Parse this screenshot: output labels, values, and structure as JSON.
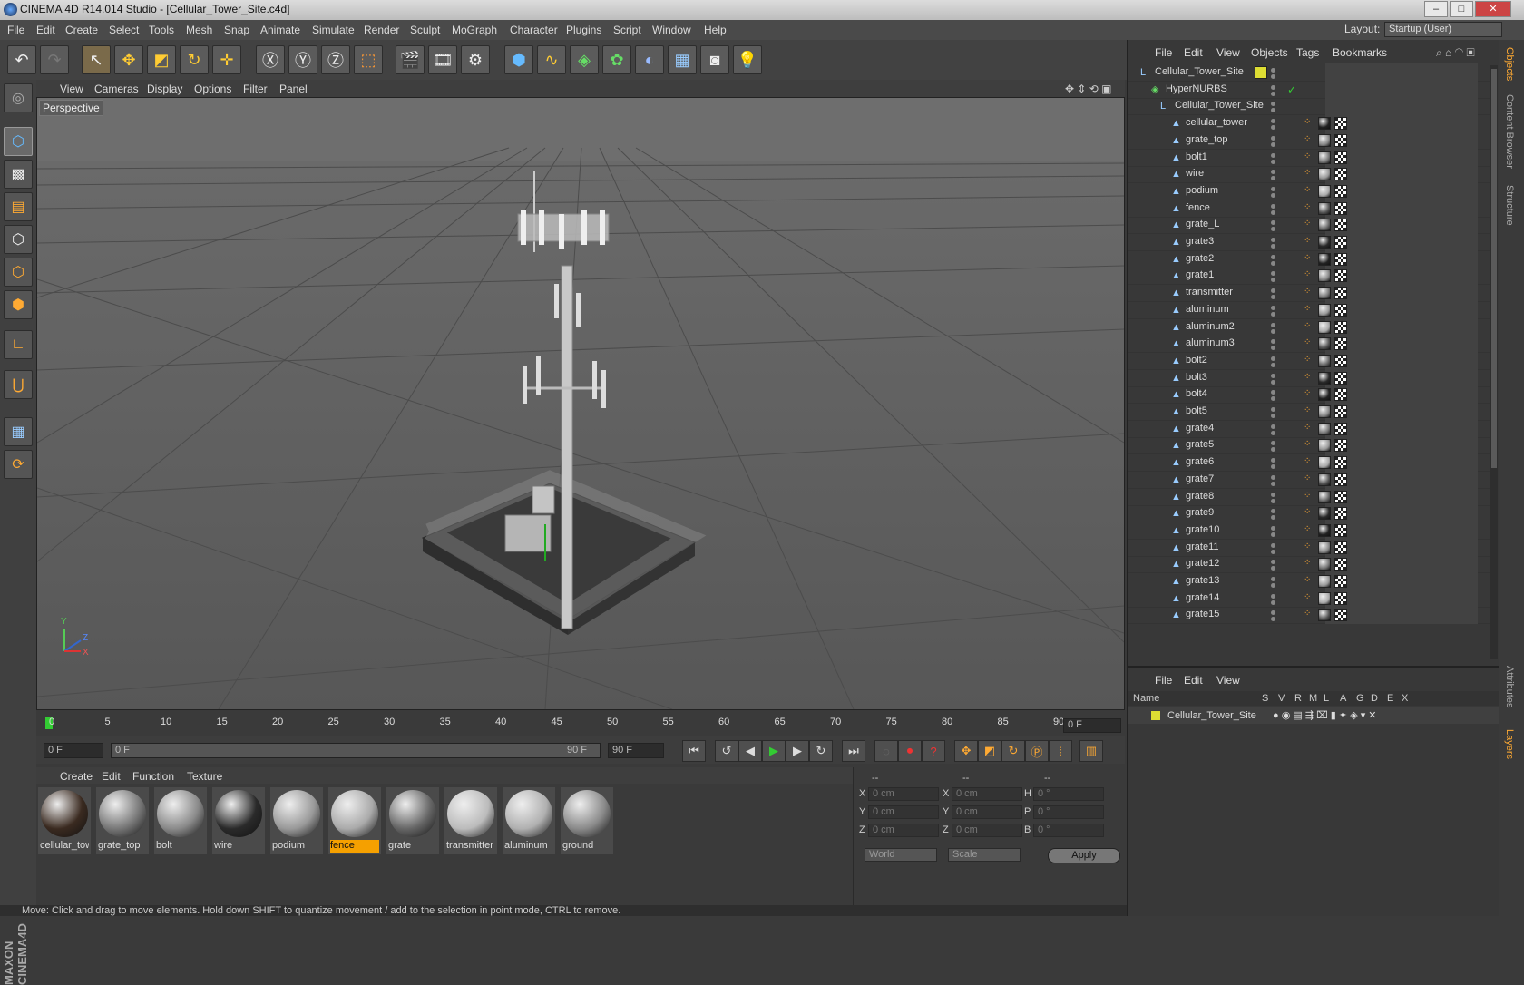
{
  "window": {
    "title": "CINEMA 4D R14.014 Studio - [Cellular_Tower_Site.c4d]"
  },
  "menubar": {
    "items": [
      "File",
      "Edit",
      "Create",
      "Select",
      "Tools",
      "Mesh",
      "Snap",
      "Animate",
      "Simulate",
      "Render",
      "Sculpt",
      "MoGraph",
      "Character",
      "Plugins",
      "Script",
      "Window",
      "Help"
    ],
    "layout_label": "Layout:",
    "layout_value": "Startup (User)"
  },
  "viewport": {
    "menu": [
      "View",
      "Cameras",
      "Display",
      "Options",
      "Filter",
      "Panel"
    ],
    "label": "Perspective",
    "axis_y": "Y",
    "axis_z": "Z",
    "axis_x": "X"
  },
  "timeline": {
    "ticks": [
      "0",
      "5",
      "10",
      "15",
      "20",
      "25",
      "30",
      "35",
      "40",
      "45",
      "50",
      "55",
      "60",
      "65",
      "70",
      "75",
      "80",
      "85",
      "90"
    ],
    "current_frame": "0 F",
    "start_field": "0 F",
    "range_start": "0 F",
    "range_end": "90 F",
    "end_field": "90 F"
  },
  "materials": {
    "menu": [
      "Create",
      "Edit",
      "Function",
      "Texture"
    ],
    "items": [
      {
        "name": "cellular_tower",
        "color": "#3a2a20"
      },
      {
        "name": "grate_top",
        "color": "#777"
      },
      {
        "name": "bolt",
        "color": "#8a8a8a"
      },
      {
        "name": "wire",
        "color": "#2a2a2a"
      },
      {
        "name": "podium",
        "color": "#999"
      },
      {
        "name": "fence",
        "color": "#aaa",
        "selected": true
      },
      {
        "name": "grate",
        "color": "#666"
      },
      {
        "name": "transmitter",
        "color": "#bbb"
      },
      {
        "name": "aluminum",
        "color": "#b0b0b0"
      },
      {
        "name": "ground",
        "color": "#8a8a8a"
      }
    ]
  },
  "coords": {
    "header": [
      "--",
      "--",
      "--"
    ],
    "rows": [
      {
        "a": "X",
        "av": "0 cm",
        "b": "X",
        "bv": "0 cm",
        "c": "H",
        "cv": "0 °"
      },
      {
        "a": "Y",
        "av": "0 cm",
        "b": "Y",
        "bv": "0 cm",
        "c": "P",
        "cv": "0 °"
      },
      {
        "a": "Z",
        "av": "0 cm",
        "b": "Z",
        "bv": "0 cm",
        "c": "B",
        "cv": "0 °"
      }
    ],
    "space": "World",
    "mode": "Scale",
    "apply": "Apply"
  },
  "statusbar": {
    "text": "Move: Click and drag to move elements. Hold down SHIFT to quantize movement / add to the selection in point mode, CTRL to remove."
  },
  "objects": {
    "menu": [
      "File",
      "Edit",
      "View",
      "Objects",
      "Tags",
      "Bookmarks"
    ],
    "rows": [
      {
        "name": "Cellular_Tower_Site",
        "level": 0
      },
      {
        "name": "HyperNURBS",
        "level": 1
      },
      {
        "name": "Cellular_Tower_Site",
        "level": 2
      },
      {
        "name": "cellular_tower",
        "level": 3
      },
      {
        "name": "grate_top",
        "level": 3
      },
      {
        "name": "bolt1",
        "level": 3
      },
      {
        "name": "wire",
        "level": 3
      },
      {
        "name": "podium",
        "level": 3
      },
      {
        "name": "fence",
        "level": 3
      },
      {
        "name": "grate_L",
        "level": 3
      },
      {
        "name": "grate3",
        "level": 3
      },
      {
        "name": "grate2",
        "level": 3
      },
      {
        "name": "grate1",
        "level": 3
      },
      {
        "name": "transmitter",
        "level": 3
      },
      {
        "name": "aluminum",
        "level": 3
      },
      {
        "name": "aluminum2",
        "level": 3
      },
      {
        "name": "aluminum3",
        "level": 3
      },
      {
        "name": "bolt2",
        "level": 3
      },
      {
        "name": "bolt3",
        "level": 3
      },
      {
        "name": "bolt4",
        "level": 3
      },
      {
        "name": "bolt5",
        "level": 3
      },
      {
        "name": "grate4",
        "level": 3
      },
      {
        "name": "grate5",
        "level": 3
      },
      {
        "name": "grate6",
        "level": 3
      },
      {
        "name": "grate7",
        "level": 3
      },
      {
        "name": "grate8",
        "level": 3
      },
      {
        "name": "grate9",
        "level": 3
      },
      {
        "name": "grate10",
        "level": 3
      },
      {
        "name": "grate11",
        "level": 3
      },
      {
        "name": "grate12",
        "level": 3
      },
      {
        "name": "grate13",
        "level": 3
      },
      {
        "name": "grate14",
        "level": 3
      },
      {
        "name": "grate15",
        "level": 3
      }
    ]
  },
  "layers": {
    "menu": [
      "File",
      "Edit",
      "View"
    ],
    "columns": [
      "Name",
      "S",
      "V",
      "R",
      "M",
      "L",
      "A",
      "G",
      "D",
      "E",
      "X"
    ],
    "row_name": "Cellular_Tower_Site"
  },
  "side_tabs": [
    "Objects",
    "Content Browser",
    "Structure",
    "Attributes",
    "Layers"
  ]
}
